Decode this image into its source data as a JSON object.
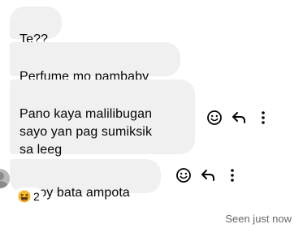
{
  "messages": [
    {
      "text": "Te??"
    },
    {
      "text": "Perfume mo pambaby"
    },
    {
      "text": "Pano kaya malilibugan\nsayo yan pag sumiksik\nsa leeg"
    },
    {
      "text": "Amoy bata ampota"
    }
  ],
  "actions": {
    "icons": [
      "smiley-icon",
      "reply-icon",
      "more-dots-icon"
    ]
  },
  "reaction": {
    "emoji": "laughing-face",
    "count": "2"
  },
  "seen_status": "Seen just now",
  "colors": {
    "bubble_bg": "#f0f0f0",
    "text": "#050505",
    "secondary_text": "#65676b",
    "reaction_emoji": "#f7b928"
  }
}
